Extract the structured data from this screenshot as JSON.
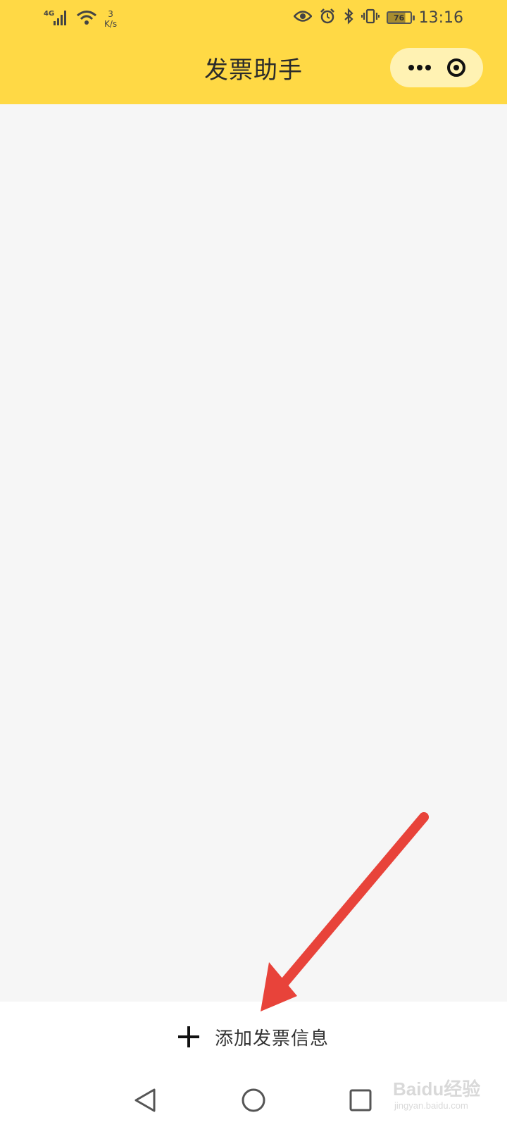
{
  "status_bar": {
    "network_type": "4G",
    "net_speed_value": "3",
    "net_speed_unit": "K/s",
    "time": "13:16",
    "battery_level": "76"
  },
  "nav": {
    "title": "发票助手"
  },
  "add_bar": {
    "label": "添加发票信息"
  },
  "watermark": {
    "brand": "Baidu经验",
    "sub": "jingyan.baidu.com"
  },
  "colors": {
    "header_bg": "#ffd945",
    "capsule_bg": "#fff2b3",
    "content_bg": "#f6f6f6",
    "annotation_arrow": "#e8433a"
  },
  "icons": {
    "capsule_more": "more-dots-icon",
    "capsule_close": "target-circle-icon",
    "add": "plus-icon",
    "back": "back-triangle-icon",
    "home": "home-circle-icon",
    "recent": "recent-square-icon"
  }
}
